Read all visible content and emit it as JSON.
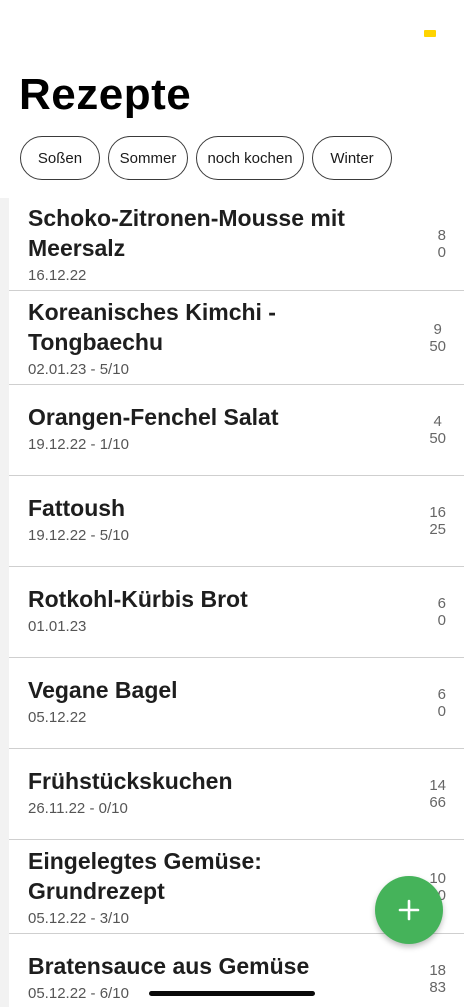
{
  "colors": {
    "accent": "#45b35a",
    "status_yellow": "#ffd400",
    "background": "#f2f2f2"
  },
  "header": {
    "title": "Rezepte"
  },
  "filters": [
    {
      "label": "Soßen"
    },
    {
      "label": "Sommer"
    },
    {
      "label": "noch kochen"
    },
    {
      "label": "Winter"
    }
  ],
  "recipes": [
    {
      "title": "Schoko-Zitronen-Mousse mit Meersalz",
      "subtitle": "16.12.22",
      "count_top": "8",
      "count_bottom": "0"
    },
    {
      "title": "Koreanisches Kimchi - Tongbaechu",
      "subtitle": "02.01.23 - 5/10",
      "count_top": "9",
      "count_bottom": "50"
    },
    {
      "title": "Orangen-Fenchel Salat",
      "subtitle": "19.12.22 - 1/10",
      "count_top": "4",
      "count_bottom": "50"
    },
    {
      "title": "Fattoush",
      "subtitle": "19.12.22 - 5/10",
      "count_top": "16",
      "count_bottom": "25"
    },
    {
      "title": "Rotkohl-Kürbis Brot",
      "subtitle": "01.01.23",
      "count_top": "6",
      "count_bottom": "0"
    },
    {
      "title": "Vegane Bagel",
      "subtitle": "05.12.22",
      "count_top": "6",
      "count_bottom": "0"
    },
    {
      "title": "Frühstückskuchen",
      "subtitle": "26.11.22 - 0/10",
      "count_top": "14",
      "count_bottom": "66"
    },
    {
      "title": "Eingelegtes Gemüse: Grundrezept",
      "subtitle": "05.12.22 - 3/10",
      "count_top": "10",
      "count_bottom": "50"
    },
    {
      "title": "Bratensauce aus Gemüse",
      "subtitle": "05.12.22 - 6/10",
      "count_top": "18",
      "count_bottom": "83"
    }
  ],
  "fab": {
    "icon": "plus-icon"
  }
}
